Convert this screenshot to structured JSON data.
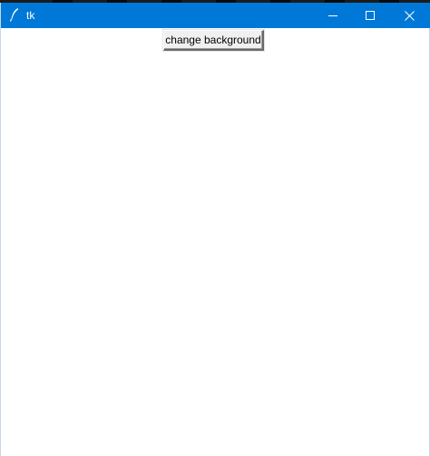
{
  "window": {
    "title": "tk",
    "titlebar_color": "#0078d7",
    "icon": "feather-icon",
    "controls": [
      "minimize-icon",
      "maximize-icon",
      "close-icon"
    ]
  },
  "main": {
    "button_label": "change background",
    "background_color": "#ffffff"
  }
}
